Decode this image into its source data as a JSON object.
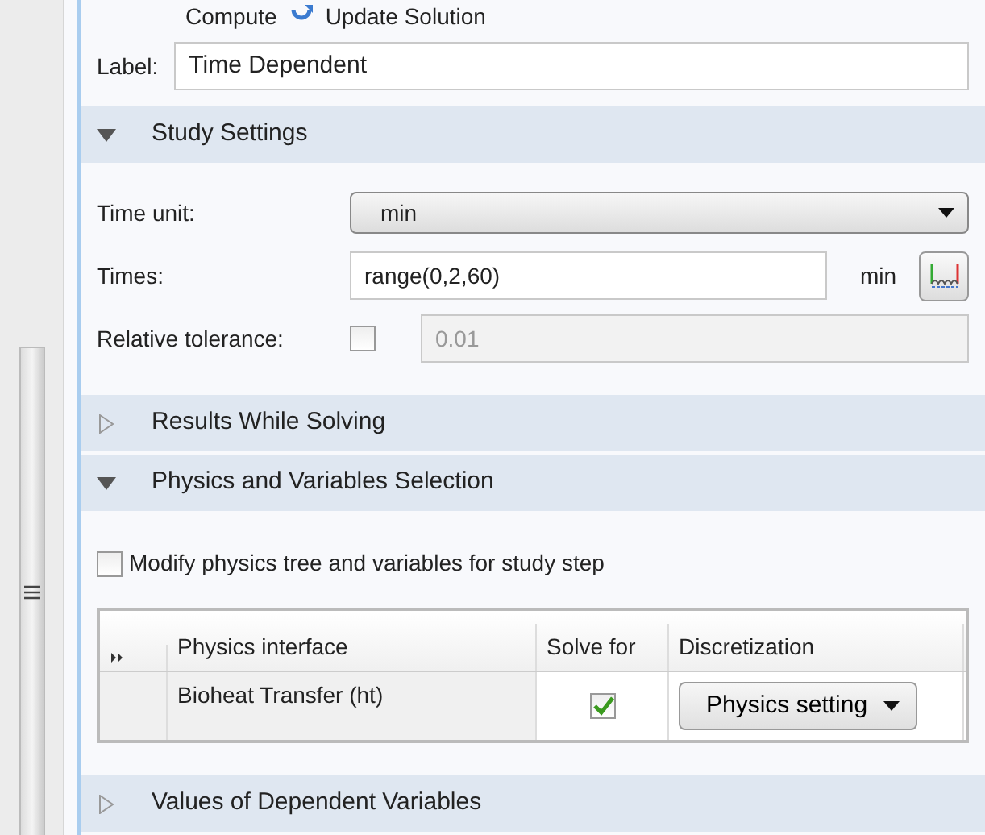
{
  "top_actions": [
    {
      "label": "Compute"
    },
    {
      "label": "Update Solution"
    }
  ],
  "label_field": {
    "label": "Label:",
    "value": "Time Dependent"
  },
  "sections": [
    {
      "title": "Study Settings",
      "expanded": true,
      "kind": "settings",
      "settings": {
        "time_unit": {
          "label": "Time unit:",
          "value": "min"
        },
        "times": {
          "label": "Times:",
          "value": "range(0,2,60)",
          "unit": "min"
        },
        "relative_tolerance": {
          "label": "Relative tolerance:",
          "checked": false,
          "value": "0.01",
          "disabled": true
        }
      }
    },
    {
      "title": "Results While Solving",
      "expanded": false
    },
    {
      "title": "Physics and Variables Selection",
      "expanded": true,
      "kind": "physics",
      "physics": {
        "modify": {
          "label": "Modify physics tree and variables for study step",
          "checked": false
        },
        "columns": [
          "Physics interface",
          "Solve for",
          "Discretization"
        ],
        "rows": [
          {
            "interface": "Bioheat Transfer (ht)",
            "solve_for": true,
            "discretization": "Physics setting"
          }
        ]
      }
    },
    {
      "title": "Values of Dependent Variables",
      "expanded": false
    }
  ]
}
